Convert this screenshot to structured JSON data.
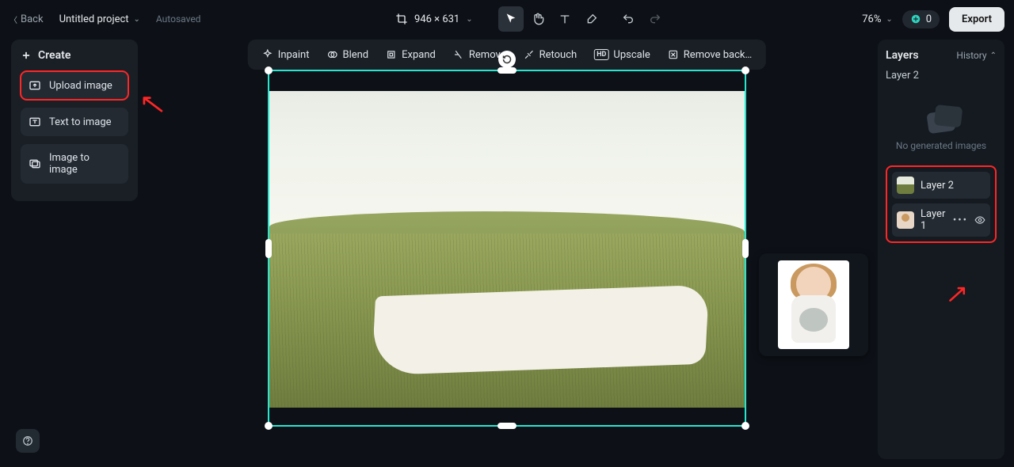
{
  "header": {
    "back_label": "Back",
    "project_title": "Untitled project",
    "autosaved_label": "Autosaved",
    "canvas_dims": "946 × 631",
    "zoom_label": "76%",
    "credits": "0",
    "export_label": "Export"
  },
  "left_panel": {
    "title": "Create",
    "items": [
      {
        "label": "Upload image",
        "icon": "upload-icon"
      },
      {
        "label": "Text to image",
        "icon": "text-icon"
      },
      {
        "label": "Image to image",
        "icon": "image-icon"
      }
    ]
  },
  "context_toolbar": {
    "items": [
      {
        "label": "Inpaint"
      },
      {
        "label": "Blend"
      },
      {
        "label": "Expand"
      },
      {
        "label": "Remove"
      },
      {
        "label": "Retouch"
      },
      {
        "label": "Upscale"
      },
      {
        "label": "Remove back…"
      }
    ]
  },
  "right_panel": {
    "title": "Layers",
    "history_label": "History",
    "selected_label": "Layer 2",
    "empty_label": "No generated images",
    "layers": [
      {
        "name": "Layer 2"
      },
      {
        "name": "Layer 1"
      }
    ]
  },
  "tools": {
    "t1": "pointer",
    "t2": "hand",
    "t3": "text",
    "t4": "brush",
    "t5": "undo",
    "t6": "redo"
  },
  "colors": {
    "accent": "#26e6d0",
    "highlight": "#ff2626"
  }
}
